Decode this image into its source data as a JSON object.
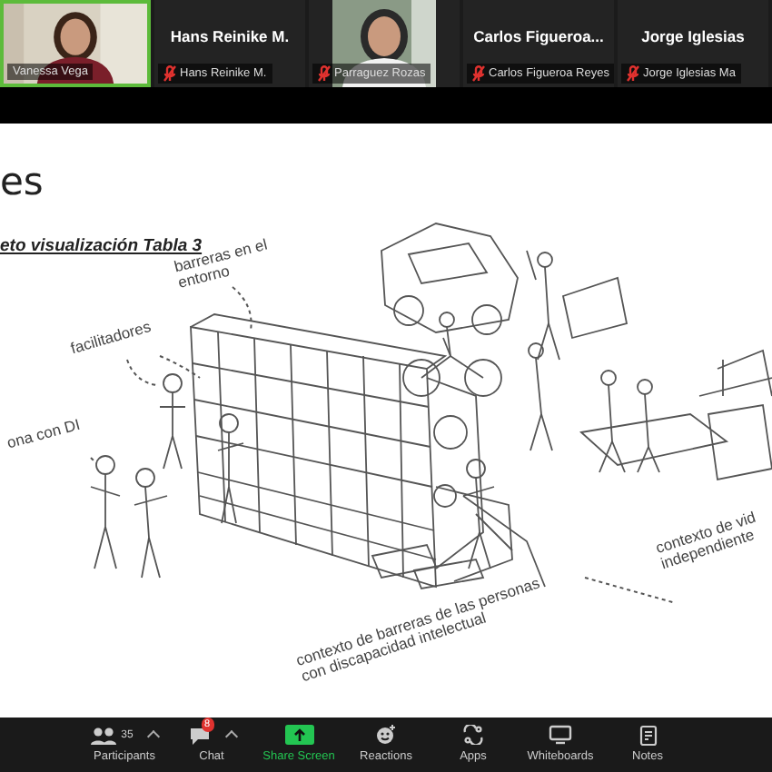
{
  "participants": [
    {
      "kind": "video",
      "label": "Vanessa Vega",
      "muted": false,
      "speaking": true
    },
    {
      "kind": "name",
      "name": "Hans Reinike M.",
      "label": "Hans Reinike M.",
      "muted": true,
      "speaking": false
    },
    {
      "kind": "video",
      "label": "Parraguez Rozas",
      "muted": true,
      "speaking": false
    },
    {
      "kind": "name",
      "name": "Carlos Figueroa...",
      "label": "Carlos Figueroa Reyes",
      "muted": true,
      "speaking": false
    },
    {
      "kind": "name",
      "name": "Jorge Iglesias",
      "label": "Jorge Iglesias Ma",
      "muted": true,
      "speaking": false
    }
  ],
  "slide": {
    "title": "es",
    "subtitle": "eto visualización Tabla 3",
    "labels": [
      {
        "kind": "environment",
        "text": "barreras en el entorno"
      },
      {
        "kind": "facilitators",
        "text": "facilitadores"
      },
      {
        "kind": "person",
        "text": "ona con DI"
      },
      {
        "kind": "barriers",
        "text": "contexto de barreras de las personas con discapacidad intelectual"
      },
      {
        "kind": "independent",
        "text": "contexto de vid independiente"
      }
    ]
  },
  "toolbar": [
    {
      "kind": "participants",
      "label": "Participants",
      "count": "35",
      "caret": true
    },
    {
      "kind": "chat",
      "label": "Chat",
      "badge": "8",
      "caret": true
    },
    {
      "kind": "share",
      "label": "Share Screen",
      "caret": false
    },
    {
      "kind": "reactions",
      "label": "Reactions",
      "caret": false
    },
    {
      "kind": "apps",
      "label": "Apps",
      "caret": false
    },
    {
      "kind": "whiteboards",
      "label": "Whiteboards",
      "caret": false
    },
    {
      "kind": "notes",
      "label": "Notes",
      "caret": false
    }
  ]
}
